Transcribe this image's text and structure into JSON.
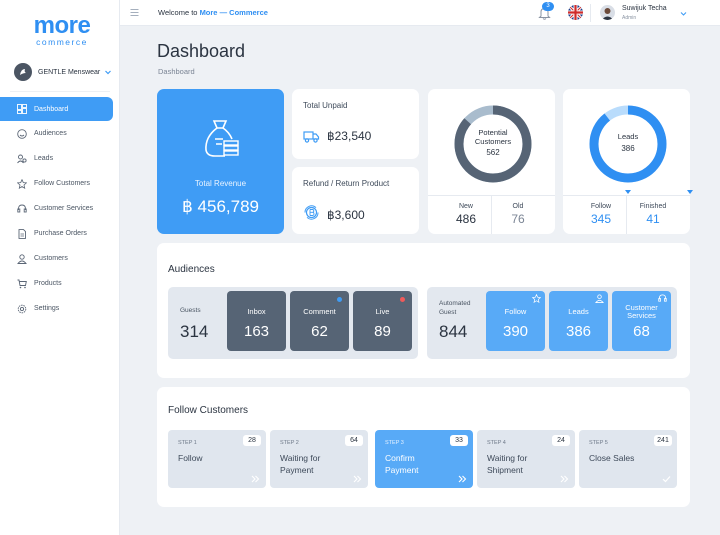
{
  "brand": {
    "logo_main": "more",
    "logo_sub": "commerce",
    "accent": "#3f9cf5"
  },
  "store": {
    "name": "GENTLE Menswear"
  },
  "sidebar": {
    "items": [
      {
        "label": "Dashboard",
        "icon": "dashboard-icon",
        "active": true
      },
      {
        "label": "Audiences",
        "icon": "audiences-icon"
      },
      {
        "label": "Leads",
        "icon": "leads-icon"
      },
      {
        "label": "Follow Customers",
        "icon": "star-icon"
      },
      {
        "label": "Customer Services",
        "icon": "headset-icon"
      },
      {
        "label": "Purchase Orders",
        "icon": "document-icon"
      },
      {
        "label": "Customers",
        "icon": "user-icon"
      },
      {
        "label": "Products",
        "icon": "cart-icon"
      },
      {
        "label": "Settings",
        "icon": "gear-icon"
      }
    ]
  },
  "topbar": {
    "welcome_prefix": "Welcome to",
    "welcome_brand": "More — Commerce",
    "notifications": "3",
    "user_name": "Suwijuk Techa",
    "user_role": "Admin"
  },
  "page": {
    "title": "Dashboard",
    "breadcrumb": "Dashboard"
  },
  "kpis": {
    "total_revenue_label": "Total Revenue",
    "total_revenue": "฿ 456,789",
    "total_unpaid_label": "Total Unpaid",
    "total_unpaid": "฿23,540",
    "refund_label": "Refund / Return Product",
    "refund": "฿3,600"
  },
  "potential_customers": {
    "label_1": "Potential",
    "label_2": "Customers",
    "value": "562",
    "new_label": "New",
    "new_value": "486",
    "old_label": "Old",
    "old_value": "76",
    "new_fraction": 0.865
  },
  "leads": {
    "label": "Leads",
    "value": "386",
    "follow_label": "Follow",
    "follow_value": "345",
    "finished_label": "Finished",
    "finished_value": "41",
    "follow_fraction": 0.894
  },
  "audiences": {
    "title": "Audiences",
    "guests_label": "Guests",
    "guests_value": "314",
    "inbox_label": "Inbox",
    "inbox_value": "163",
    "comment_label": "Comment",
    "comment_value": "62",
    "live_label": "Live",
    "live_value": "89",
    "auto_label_1": "Automated",
    "auto_label_2": "Guest",
    "auto_value": "844",
    "follow_label": "Follow",
    "follow_value": "390",
    "leads_label": "Leads",
    "leads_value": "386",
    "cs_label_1": "Customer",
    "cs_label_2": "Services",
    "cs_value": "68"
  },
  "follow_customers": {
    "title": "Follow Customers",
    "steps": [
      {
        "step": "STEP 1",
        "count": "28",
        "line1": "Follow",
        "line2": ""
      },
      {
        "step": "STEP 2",
        "count": "64",
        "line1": "Waiting for",
        "line2": "Payment"
      },
      {
        "step": "STEP 3",
        "count": "33",
        "line1": "Confirm",
        "line2": "Payment"
      },
      {
        "step": "STEP 4",
        "count": "24",
        "line1": "Waiting for",
        "line2": "Shipment"
      },
      {
        "step": "STEP 5",
        "count": "241",
        "line1": "Close Sales",
        "line2": ""
      }
    ]
  }
}
